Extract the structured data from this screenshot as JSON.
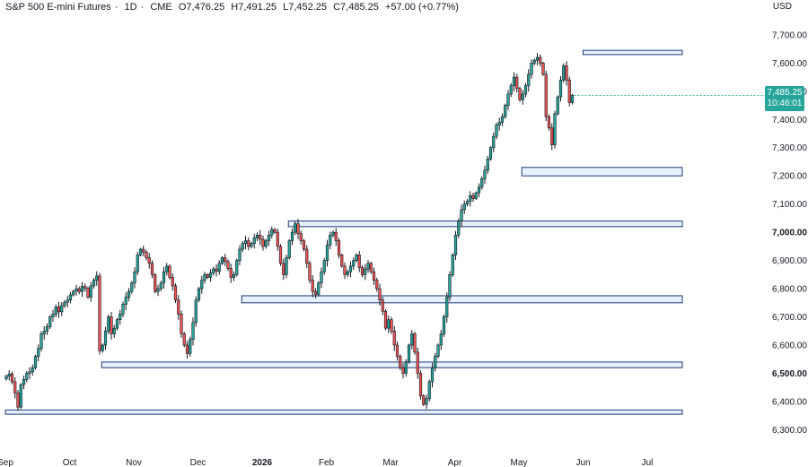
{
  "header": {
    "symbol": "S&P 500 E-mini Futures",
    "interval": "1D",
    "exchange": "CME",
    "open": "O7,476.25",
    "high": "H7,491.25",
    "low": "L7,452.25",
    "close": "C7,485.25",
    "change": "+57.00 (+0.77%)",
    "currency": "USD"
  },
  "last_price": {
    "price": "7,485.25",
    "countdown": "10:46:01",
    "value": 7485.25
  },
  "colors": {
    "up": "#26a69a",
    "down": "#ef5350",
    "zone_fill": "#e8f0fb",
    "zone_stroke": "#1e3a78"
  },
  "chart_data": {
    "type": "candlestick",
    "ylim": [
      6260,
      7760
    ],
    "y_ticks": [
      "6,300.00",
      "6,400.00",
      "6,500.00",
      "6,600.00",
      "6,700.00",
      "6,800.00",
      "6,900.00",
      "7,000.00",
      "7,100.00",
      "7,200.00",
      "7,300.00",
      "7,400.00",
      "7,500.00",
      "7,600.00",
      "7,700.00"
    ],
    "y_tick_values": [
      6300,
      6400,
      6500,
      6600,
      6700,
      6800,
      6900,
      7000,
      7100,
      7200,
      7300,
      7400,
      7500,
      7600,
      7700
    ],
    "y_bold": [
      "7,000.00",
      "6,500.00"
    ],
    "x_ticks": [
      "Sep",
      "Oct",
      "Nov",
      "Dec",
      "2026",
      "Feb",
      "Mar",
      "Apr",
      "May",
      "Jun",
      "Jul"
    ],
    "x_bold": [
      "2026"
    ],
    "x_tick_index": [
      0,
      22,
      44,
      66,
      88,
      110,
      132,
      154,
      176,
      198,
      220
    ],
    "zones": [
      {
        "bottom": 7630,
        "top": 7645,
        "start": 198,
        "end": 232
      },
      {
        "bottom": 7200,
        "top": 7230,
        "start": 177,
        "end": 232
      },
      {
        "bottom": 7020,
        "top": 7040,
        "start": 97,
        "end": 232
      },
      {
        "bottom": 6750,
        "top": 6775,
        "start": 81,
        "end": 232
      },
      {
        "bottom": 6520,
        "top": 6540,
        "start": 33,
        "end": 232
      },
      {
        "bottom": 6355,
        "top": 6370,
        "start": 0,
        "end": 232
      }
    ],
    "close": [
      6490,
      6498,
      6470,
      6430,
      6380,
      6460,
      6478,
      6500,
      6505,
      6520,
      6560,
      6588,
      6640,
      6650,
      6665,
      6700,
      6710,
      6735,
      6718,
      6740,
      6752,
      6760,
      6778,
      6791,
      6800,
      6790,
      6808,
      6802,
      6770,
      6810,
      6830,
      6845,
      6580,
      6600,
      6650,
      6700,
      6640,
      6660,
      6690,
      6710,
      6745,
      6770,
      6790,
      6820,
      6860,
      6920,
      6940,
      6930,
      6910,
      6890,
      6850,
      6790,
      6800,
      6820,
      6860,
      6880,
      6840,
      6810,
      6760,
      6710,
      6640,
      6600,
      6570,
      6620,
      6680,
      6760,
      6800,
      6830,
      6850,
      6840,
      6856,
      6870,
      6862,
      6890,
      6910,
      6896,
      6872,
      6840,
      6850,
      6900,
      6940,
      6960,
      6970,
      6950,
      6960,
      6980,
      6990,
      6975,
      6950,
      6970,
      6990,
      7010,
      7000,
      6950,
      6890,
      6850,
      6910,
      6970,
      7000,
      7030,
      6995,
      6970,
      6940,
      6890,
      6830,
      6790,
      6780,
      6820,
      6860,
      6900,
      6955,
      6990,
      7000,
      6970,
      6920,
      6880,
      6850,
      6860,
      6880,
      6900,
      6920,
      6875,
      6850,
      6870,
      6890,
      6860,
      6830,
      6800,
      6760,
      6720,
      6660,
      6690,
      6650,
      6600,
      6560,
      6520,
      6500,
      6540,
      6600,
      6640,
      6575,
      6500,
      6420,
      6390,
      6410,
      6470,
      6520,
      6560,
      6600,
      6640,
      6700,
      6770,
      6850,
      6920,
      6990,
      7040,
      7080,
      7100,
      7110,
      7130,
      7120,
      7140,
      7160,
      7190,
      7220,
      7260,
      7300,
      7340,
      7380,
      7390,
      7410,
      7450,
      7490,
      7520,
      7550,
      7510,
      7470,
      7490,
      7520,
      7560,
      7600,
      7610,
      7620,
      7600,
      7560,
      7410,
      7370,
      7310,
      7420,
      7480,
      7540,
      7590,
      7540,
      7460,
      7485
    ]
  }
}
